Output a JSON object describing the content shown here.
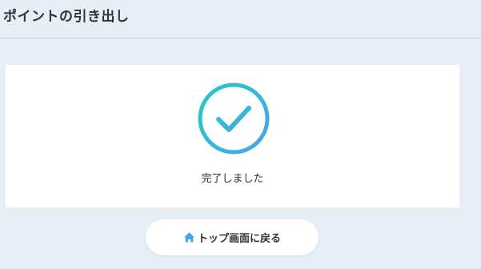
{
  "header": {
    "title": "ポイントの引き出し"
  },
  "result": {
    "icon": "check-circle-icon",
    "message": "完了しました"
  },
  "actions": {
    "back_to_top_label": "トップ画面に戻る",
    "back_to_top_icon": "home-icon"
  },
  "colors": {
    "background": "#e8eef6",
    "card": "#ffffff",
    "check_gradient_start": "#27c9c2",
    "check_gradient_end": "#4aa3f0",
    "home_icon": "#3ea6e6"
  }
}
